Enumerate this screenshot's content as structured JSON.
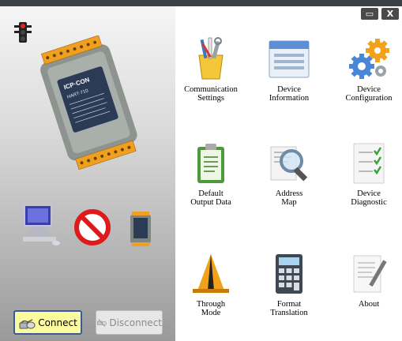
{
  "window": {
    "minimize_label": "▭",
    "close_label": "X"
  },
  "buttons": {
    "connect": "Connect",
    "disconnect": "Disconnect"
  },
  "device": {
    "brand": "ICP·CON",
    "model": "HART-710"
  },
  "tiles": [
    {
      "label": "Communication\nSettings",
      "icon": "wrench-pencil-cup-icon"
    },
    {
      "label": "Device\nInformation",
      "icon": "window-info-icon"
    },
    {
      "label": "Device\nConfiguration",
      "icon": "gears-icon"
    },
    {
      "label": "Default\nOutput Data",
      "icon": "clipboard-icon"
    },
    {
      "label": "Address\nMap",
      "icon": "magnifier-document-icon"
    },
    {
      "label": "Device\nDiagnostic",
      "icon": "checklist-icon"
    },
    {
      "label": "Through\nMode",
      "icon": "traffic-cone-icon"
    },
    {
      "label": "Format\nTranslation",
      "icon": "calculator-icon"
    },
    {
      "label": "About",
      "icon": "note-pen-icon"
    }
  ],
  "colors": {
    "connect_bg": "#fdfc9c",
    "connect_border": "#3a5a9c",
    "disconnect_text": "#8b8b8b",
    "orange_terminals": "#f0a020"
  }
}
